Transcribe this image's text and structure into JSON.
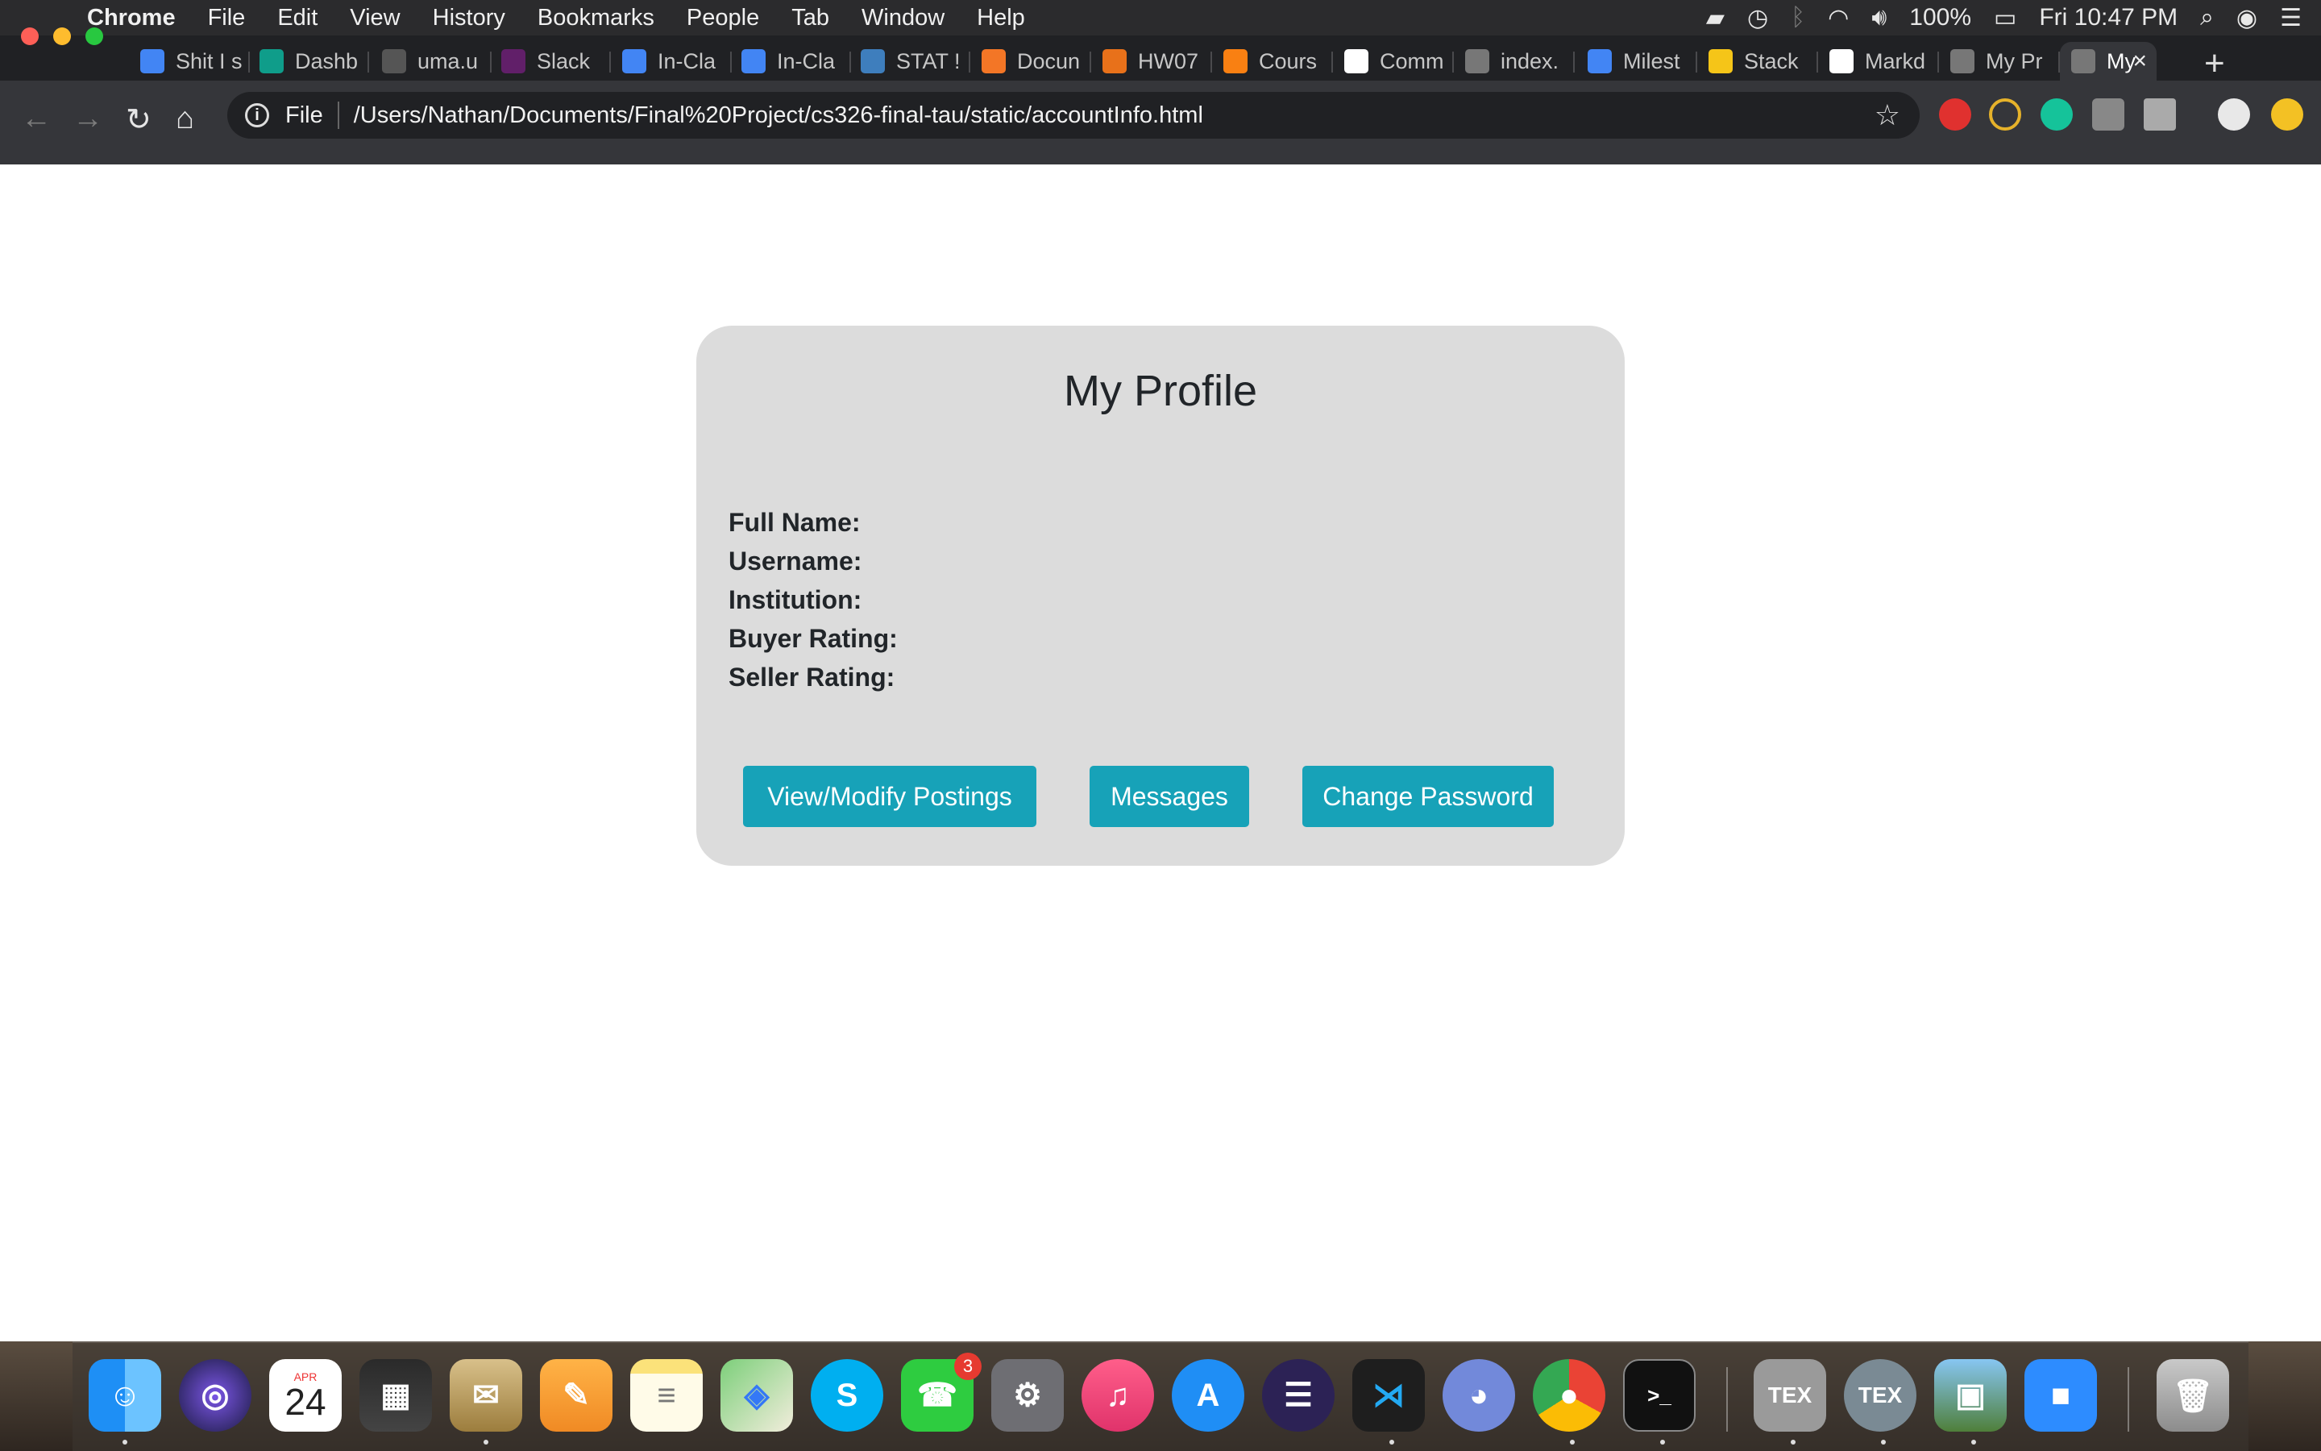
{
  "menubar": {
    "app": "Chrome",
    "items": [
      "File",
      "Edit",
      "View",
      "History",
      "Bookmarks",
      "People",
      "Tab",
      "Window",
      "Help"
    ],
    "battery": "100%",
    "clock": "Fri 10:47 PM"
  },
  "tabs": [
    {
      "label": "Shit I s",
      "icon": "google-docs-icon",
      "color": "#4285f4"
    },
    {
      "label": "Dashb",
      "icon": "analytics-icon",
      "color": "#0f9d8a"
    },
    {
      "label": "uma.u",
      "icon": "blackboard-icon",
      "color": "#555555"
    },
    {
      "label": "Slack",
      "icon": "slack-icon",
      "color": "#611f69"
    },
    {
      "label": "In-Cla",
      "icon": "google-docs-icon",
      "color": "#4285f4"
    },
    {
      "label": "In-Cla",
      "icon": "google-docs-icon",
      "color": "#4285f4"
    },
    {
      "label": "STAT !",
      "icon": "piazza-icon",
      "color": "#3e7ebd"
    },
    {
      "label": "Docun",
      "icon": "jupyter-icon",
      "color": "#f37626"
    },
    {
      "label": "HW07",
      "icon": "book-icon",
      "color": "#e8711a"
    },
    {
      "label": "Cours",
      "icon": "moodle-icon",
      "color": "#f98012"
    },
    {
      "label": "Comm",
      "icon": "github-icon",
      "color": "#ffffff"
    },
    {
      "label": "index.",
      "icon": "globe-icon",
      "color": "#777777"
    },
    {
      "label": "Milest",
      "icon": "google-docs-icon",
      "color": "#4285f4"
    },
    {
      "label": "Stack",
      "icon": "stackedit-icon",
      "color": "#f5c518"
    },
    {
      "label": "Markd",
      "icon": "github-icon",
      "color": "#ffffff"
    },
    {
      "label": "My Pr",
      "icon": "globe-icon",
      "color": "#777777"
    },
    {
      "label": "My",
      "icon": "globe-icon",
      "color": "#777777",
      "active": true
    }
  ],
  "address": {
    "scheme": "File",
    "url": "/Users/Nathan/Documents/Final%20Project/cs326-final-tau/static/accountInfo.html"
  },
  "profile": {
    "title": "My Profile",
    "fields": [
      "Full Name:",
      "Username:",
      "Institution:",
      "Buyer Rating:",
      "Seller Rating:"
    ],
    "buttons": {
      "postings": "View/Modify Postings",
      "messages": "Messages",
      "password": "Change Password"
    }
  },
  "dock": {
    "calendar_month": "APR",
    "calendar_day": "24",
    "facetime_badge": "3"
  },
  "colors": {
    "accent": "#17a2b8",
    "card": "#dcdcdc"
  }
}
